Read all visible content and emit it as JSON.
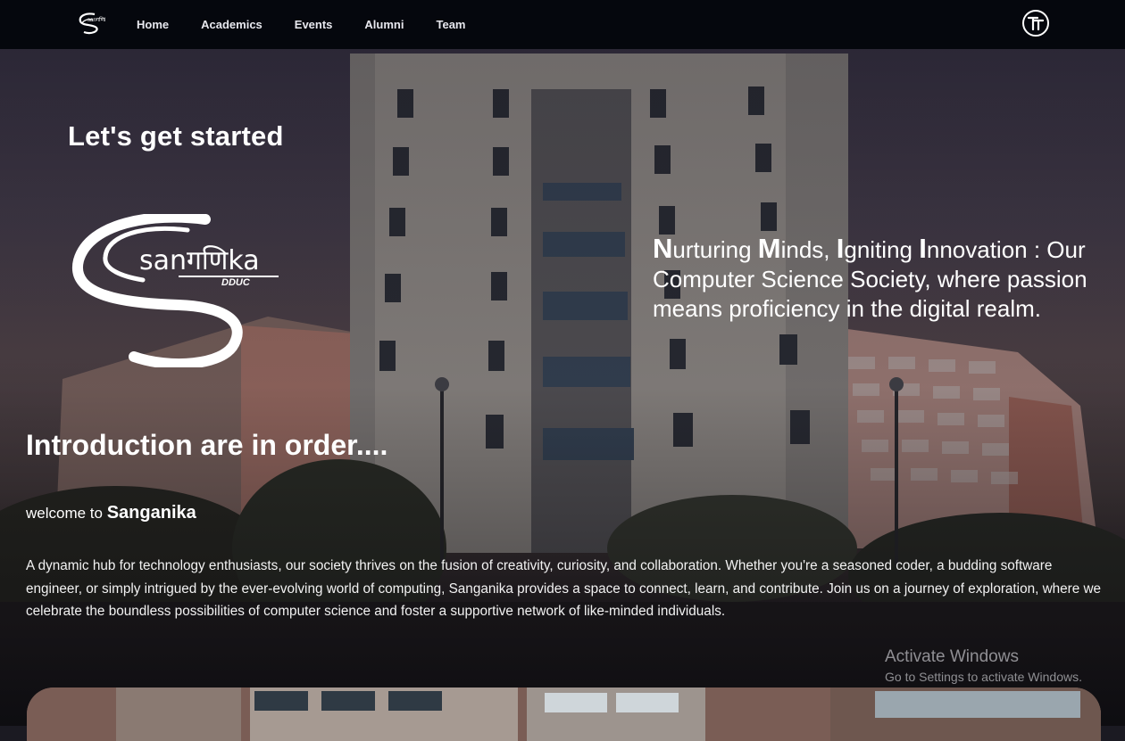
{
  "nav": {
    "items": [
      {
        "label": "Home"
      },
      {
        "label": "Academics"
      },
      {
        "label": "Events"
      },
      {
        "label": "Alumni"
      },
      {
        "label": "Team"
      }
    ]
  },
  "hero": {
    "heading": "Let's get started",
    "logo_text": "sanगणिka",
    "logo_subtext": "DDUC",
    "tagline": {
      "w1_initial": "N",
      "w1_rest": "urturing ",
      "w2_initial": "M",
      "w2_rest": "inds, ",
      "w3_initial": "I",
      "w3_rest": "gniting ",
      "w4_initial": "I",
      "w4_rest": "nnovation :",
      "rest": " Our Computer Science Society, where passion means proficiency in the digital realm."
    }
  },
  "intro": {
    "heading": "Introduction are in order....",
    "welcome_prefix": "welcome to ",
    "welcome_brand": "Sanganika",
    "description": "A dynamic hub for technology enthusiasts, our society thrives on the fusion of creativity, curiosity, and collaboration. Whether you're a seasoned coder, a budding software engineer, or simply intrigued by the ever-evolving world of computing, Sanganika provides a space to connect, learn, and contribute. Join us on a journey of exploration, where we celebrate the boundless possibilities of computer science and foster a supportive network of like-minded individuals."
  },
  "watermark": {
    "title": "Activate Windows",
    "subtitle": "Go to Settings to activate Windows."
  },
  "icons": {
    "nav_logo": "sanganika-logo-icon",
    "right_logo": "tt-monogram-icon"
  }
}
